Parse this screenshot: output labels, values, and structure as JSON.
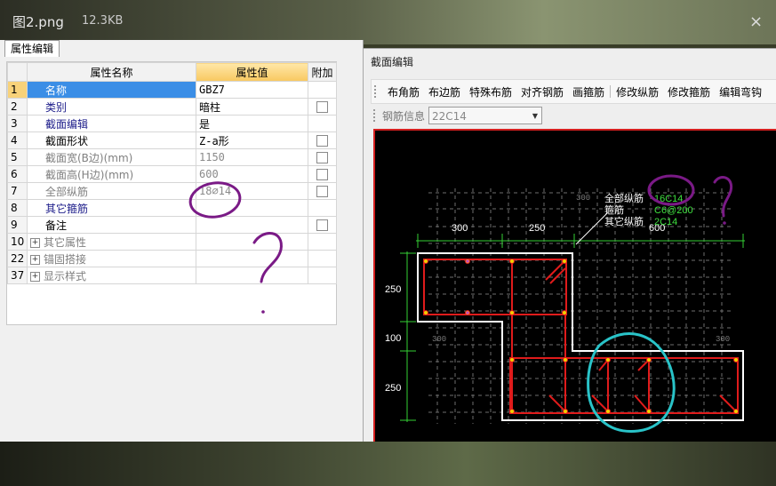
{
  "viewer": {
    "file_name": "图2.png",
    "file_size": "12.3KB",
    "close_glyph": "×"
  },
  "tabs": [
    {
      "label": "属性编辑"
    }
  ],
  "grid": {
    "headers": {
      "name": "属性名称",
      "value": "属性值",
      "add": "附加"
    },
    "rows": [
      {
        "num": "1",
        "name": "名称",
        "value": "GBZ7",
        "check": false,
        "expand": false,
        "style": "sel"
      },
      {
        "num": "2",
        "name": "类别",
        "value": "暗柱",
        "check": true,
        "expand": false,
        "style": "blue"
      },
      {
        "num": "3",
        "name": "截面编辑",
        "value": "是",
        "check": false,
        "expand": false,
        "style": "blue"
      },
      {
        "num": "4",
        "name": "截面形状",
        "value": "Z-a形",
        "check": true,
        "expand": false,
        "style": "black"
      },
      {
        "num": "5",
        "name": "截面宽(B边)(mm)",
        "value": "1150",
        "check": true,
        "expand": false,
        "style": "gray"
      },
      {
        "num": "6",
        "name": "截面高(H边)(mm)",
        "value": "600",
        "check": true,
        "expand": false,
        "style": "gray"
      },
      {
        "num": "7",
        "name": "全部纵筋",
        "value": "18⌀14",
        "check": true,
        "expand": false,
        "style": "gray"
      },
      {
        "num": "8",
        "name": "其它箍筋",
        "value": "",
        "check": false,
        "expand": false,
        "style": "blue"
      },
      {
        "num": "9",
        "name": "备注",
        "value": "",
        "check": true,
        "expand": false,
        "style": "black"
      },
      {
        "num": "10",
        "name": "其它属性",
        "value": "",
        "check": false,
        "expand": true,
        "style": "gray"
      },
      {
        "num": "22",
        "name": "锚固搭接",
        "value": "",
        "check": false,
        "expand": true,
        "style": "gray"
      },
      {
        "num": "37",
        "name": "显示样式",
        "value": "",
        "check": false,
        "expand": true,
        "style": "gray"
      }
    ]
  },
  "dialog": {
    "title": "截面编辑",
    "toolbar": [
      "布角筋",
      "布边筋",
      "特殊布筋",
      "对齐钢筋",
      "画箍筋",
      "修改纵筋",
      "修改箍筋",
      "编辑弯钩"
    ],
    "rebar_info_label": "钢筋信息",
    "rebar_info_value": "22C14"
  },
  "drawing": {
    "dims_top": [
      "300",
      "250",
      "600"
    ],
    "dims_left": [
      "250",
      "100",
      "250"
    ],
    "grid_labels": [
      "300",
      "300",
      "300"
    ],
    "legend": [
      {
        "label": "全部纵筋",
        "value": "16C14"
      },
      {
        "label": "箍筋",
        "value": "C6@200"
      },
      {
        "label": "其它纵筋",
        "value": "2C14"
      }
    ],
    "colors": {
      "outline": "#ffffff",
      "stirrup": "#e01b1b",
      "dimension": "#35d035",
      "legend_value": "#3fe03f",
      "annotation_purple": "#7a1a86",
      "annotation_cyan": "#29c3c8",
      "grid": "#6e6e6e"
    }
  },
  "annotations": {
    "question_mark": "?"
  }
}
